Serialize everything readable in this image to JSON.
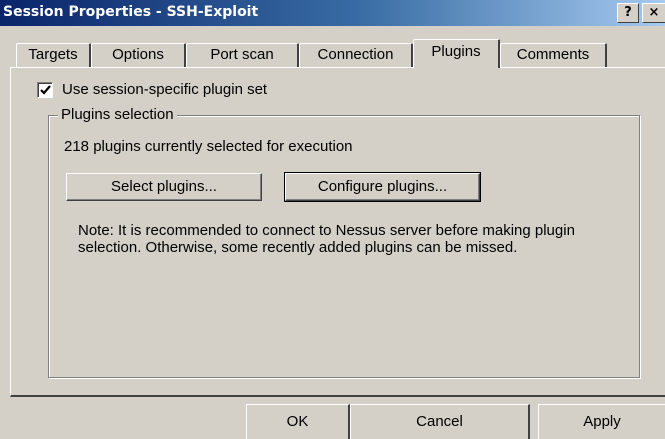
{
  "window": {
    "title": "Session Properties - SSH-Exploit",
    "help_glyph": "?",
    "close_glyph": "×"
  },
  "tabs": [
    {
      "label": "Targets",
      "active": false
    },
    {
      "label": "Options",
      "active": false
    },
    {
      "label": "Port scan",
      "active": false
    },
    {
      "label": "Connection",
      "active": false
    },
    {
      "label": "Plugins",
      "active": true
    },
    {
      "label": "Comments",
      "active": false
    }
  ],
  "plugins_tab": {
    "use_specific_label": "Use session-specific plugin set",
    "use_specific_checked": true,
    "group_title": "Plugins selection",
    "status": "218 plugins currently selected for execution",
    "select_button": "Select plugins...",
    "configure_button": "Configure plugins...",
    "note": "Note: It is recommended to connect to Nessus server before making plugin selection. Otherwise, some recently added plugins can be missed."
  },
  "buttons": {
    "ok": "OK",
    "cancel": "Cancel",
    "apply": "Apply"
  },
  "colors": {
    "face": "#d4d0c8",
    "titlebar_start": "#0a246a",
    "titlebar_end": "#a6caf0"
  }
}
